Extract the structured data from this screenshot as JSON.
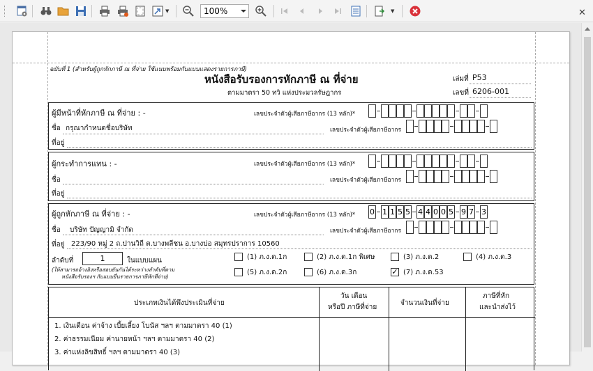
{
  "toolbar": {
    "zoom_value": "100%",
    "icons": [
      "settings-icon",
      "find-icon",
      "open-icon",
      "save-icon",
      "print-icon",
      "print-setup-icon",
      "page-setup-icon",
      "scale-icon",
      "zoom-out-icon",
      "zoom-in-icon",
      "first-page-icon",
      "prev-page-icon",
      "next-page-icon",
      "last-page-icon",
      "parameters-icon",
      "export-icon",
      "close-icon"
    ],
    "close_label": "✕"
  },
  "doc": {
    "note": "ฉบับที่ 1 (สำหรับผู้ถูกหักภาษี ณ ที่จ่าย ใช้แนบพร้อมกับแบบแสดงรายการภาษี)",
    "title": "หนังสือรับรองการหักภาษี ณ ที่จ่าย",
    "subtitle": "ตามมาตรา 50 ทวิ แห่งประมวลรัษฎากร",
    "book_label": "เล่มที่",
    "book_value": "P53",
    "no_label": "เลขที่",
    "no_value": "6206-001",
    "payer": {
      "heading": "ผู้มีหน้าที่หักภาษี ณ ที่จ่าย : -",
      "tax13_label": "เลขประจำตัวผู้เสียภาษีอากร (13 หลัก)*",
      "name_label": "ชื่อ",
      "name_value": "กรุณากำหนดชื่อบริษัท",
      "taxid_label": "เลขประจำตัวผู้เสียภาษีอากร",
      "address_label": "ที่อยู่"
    },
    "agent": {
      "heading": "ผู้กระทำการแทน : -",
      "tax13_label": "เลขประจำตัวผู้เสียภาษีอากร (13 หลัก)*",
      "name_label": "ชื่อ",
      "taxid_label": "เลขประจำตัวผู้เสียภาษีอากร",
      "address_label": "ที่อยู่"
    },
    "payee": {
      "heading": "ผู้ถูกหักภาษี ณ ที่จ่าย : -",
      "tax13_label": "เลขประจำตัวผู้เสียภาษีอากร (13 หลัก)*",
      "tax13_digits": [
        "0",
        "1",
        "1",
        "5",
        "5",
        "4",
        "4",
        "0",
        "0",
        "5",
        "9",
        "7",
        "3"
      ],
      "name_label": "ชื่อ",
      "name_value": "บริษัท ปัญญามิ จำกัด",
      "taxid_label": "เลขประจำตัวผู้เสียภาษีอากร",
      "address_label": "ที่อยู่",
      "address_value": "223/90 หมู่ 2 ถ.ปานวิถี ต.บางพลีชน อ.บางบ่อ สมุทรปราการ 10560"
    },
    "seq_label": "ลำดับที่",
    "seq_value": "1",
    "seq_suffix": "ในแบบแผน",
    "seq_note_1": "(ให้สามารถอ้างอิงหรือสอบยันกันได้ระหว่างลำดับที่ตาม",
    "seq_note_2": "หนังสือรับรองฯ กับแบบยื่นรายการภาษีหักที่จ่าย)",
    "forms": [
      {
        "label": "(1) ภ.ง.ด.1ก",
        "checked": false
      },
      {
        "label": "(2) ภ.ง.ด.1ก พิเศษ",
        "checked": false
      },
      {
        "label": "(3) ภ.ง.ด.2",
        "checked": false
      },
      {
        "label": "(4) ภ.ง.ด.3",
        "checked": false
      },
      {
        "label": "(5) ภ.ง.ด.2ก",
        "checked": false
      },
      {
        "label": "(6) ภ.ง.ด.3ก",
        "checked": false
      },
      {
        "label": "(7) ภ.ง.ด.53",
        "checked": true
      }
    ],
    "check_mark": "✓",
    "table": {
      "col1": "ประเภทเงินได้พึงประเมินที่จ่าย",
      "col2_line1": "วัน เดือน",
      "col2_line2": "หรือปี ภาษีที่จ่าย",
      "col3": "จำนวนเงินที่จ่าย",
      "col4_line1": "ภาษีที่หัก",
      "col4_line2": "และนำส่งไว้",
      "rows": [
        "1.   เงินเดือน ค่าจ้าง เบี้ยเลี้ยง โบนัส ฯลฯ ตามมาตรา 40 (1)",
        "2.   ค่าธรรมเนียม ค่านายหน้า ฯลฯ ตามมาตรา 40 (2)",
        "3.   ค่าแห่งลิขสิทธิ์ ฯลฯ ตามมาตรา 40 (3)"
      ]
    }
  }
}
